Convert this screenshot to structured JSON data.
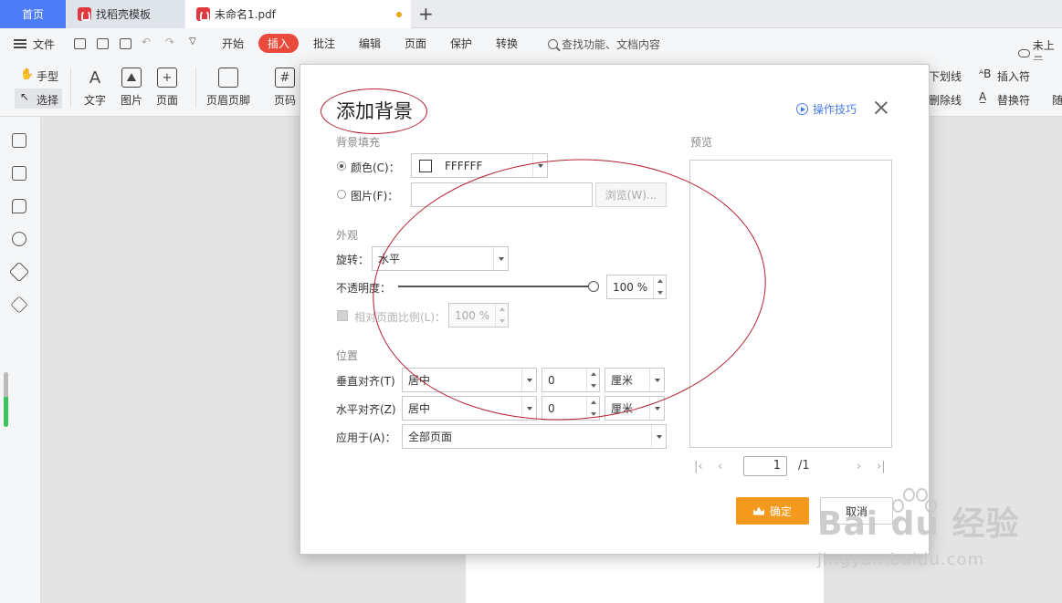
{
  "tabs": [
    {
      "label": "首页"
    },
    {
      "label": "找稻壳模板"
    },
    {
      "label": "未命名1.pdf"
    }
  ],
  "menubar": {
    "file": "文件",
    "tabs": [
      "开始",
      "插入",
      "批注",
      "编辑",
      "页面",
      "保护",
      "转换"
    ],
    "active_tab": "插入",
    "search_placeholder": "查找功能、文档内容",
    "cloud_status": "未上云"
  },
  "toolbar": {
    "hand": "手型",
    "select": "选择",
    "text": "文字",
    "image": "图片",
    "page": "页面",
    "header_footer": "页眉页脚",
    "page_number": "页码",
    "underline": "下划线",
    "insert_symbol": "插入符",
    "strikethrough": "删除线",
    "replace_symbol": "替换符",
    "partial_right": "随"
  },
  "dialog": {
    "title": "添加背景",
    "help_link": "操作技巧",
    "fill_section": "背景填充",
    "color_label": "颜色(C)：",
    "color_value": "FFFFFF",
    "image_label": "图片(F)：",
    "image_value": "",
    "browse": "浏览(W)...",
    "appearance_section": "外观",
    "rotation_label": "旋转：",
    "rotation_value": "水平",
    "opacity_label": "不透明度：",
    "opacity_value": "100 %",
    "opacity_fraction": 1.0,
    "scale_label": "相对页面比例(L)：",
    "scale_value": "100 %",
    "position_section": "位置",
    "vertical_label": "垂直对齐(T)",
    "vertical_value": "居中",
    "vertical_offset": "0",
    "vertical_unit": "厘米",
    "horizontal_label": "水平对齐(Z)",
    "horizontal_value": "居中",
    "horizontal_offset": "0",
    "horizontal_unit": "厘米",
    "apply_label": "应用于(A)：",
    "apply_value": "全部页面",
    "preview_label": "预览",
    "current_page": "1",
    "total_pages": "/1",
    "ok": "确定",
    "cancel": "取消"
  },
  "watermark": {
    "main": "Bai du 经验",
    "sub": "jingyan.baidu.com"
  },
  "colors": {
    "home_tab": "#4d7cf7",
    "active_menu": "#e84b3c",
    "ok_button": "#f39a1e",
    "link": "#4a7ce8",
    "annotation": "#b52030"
  }
}
